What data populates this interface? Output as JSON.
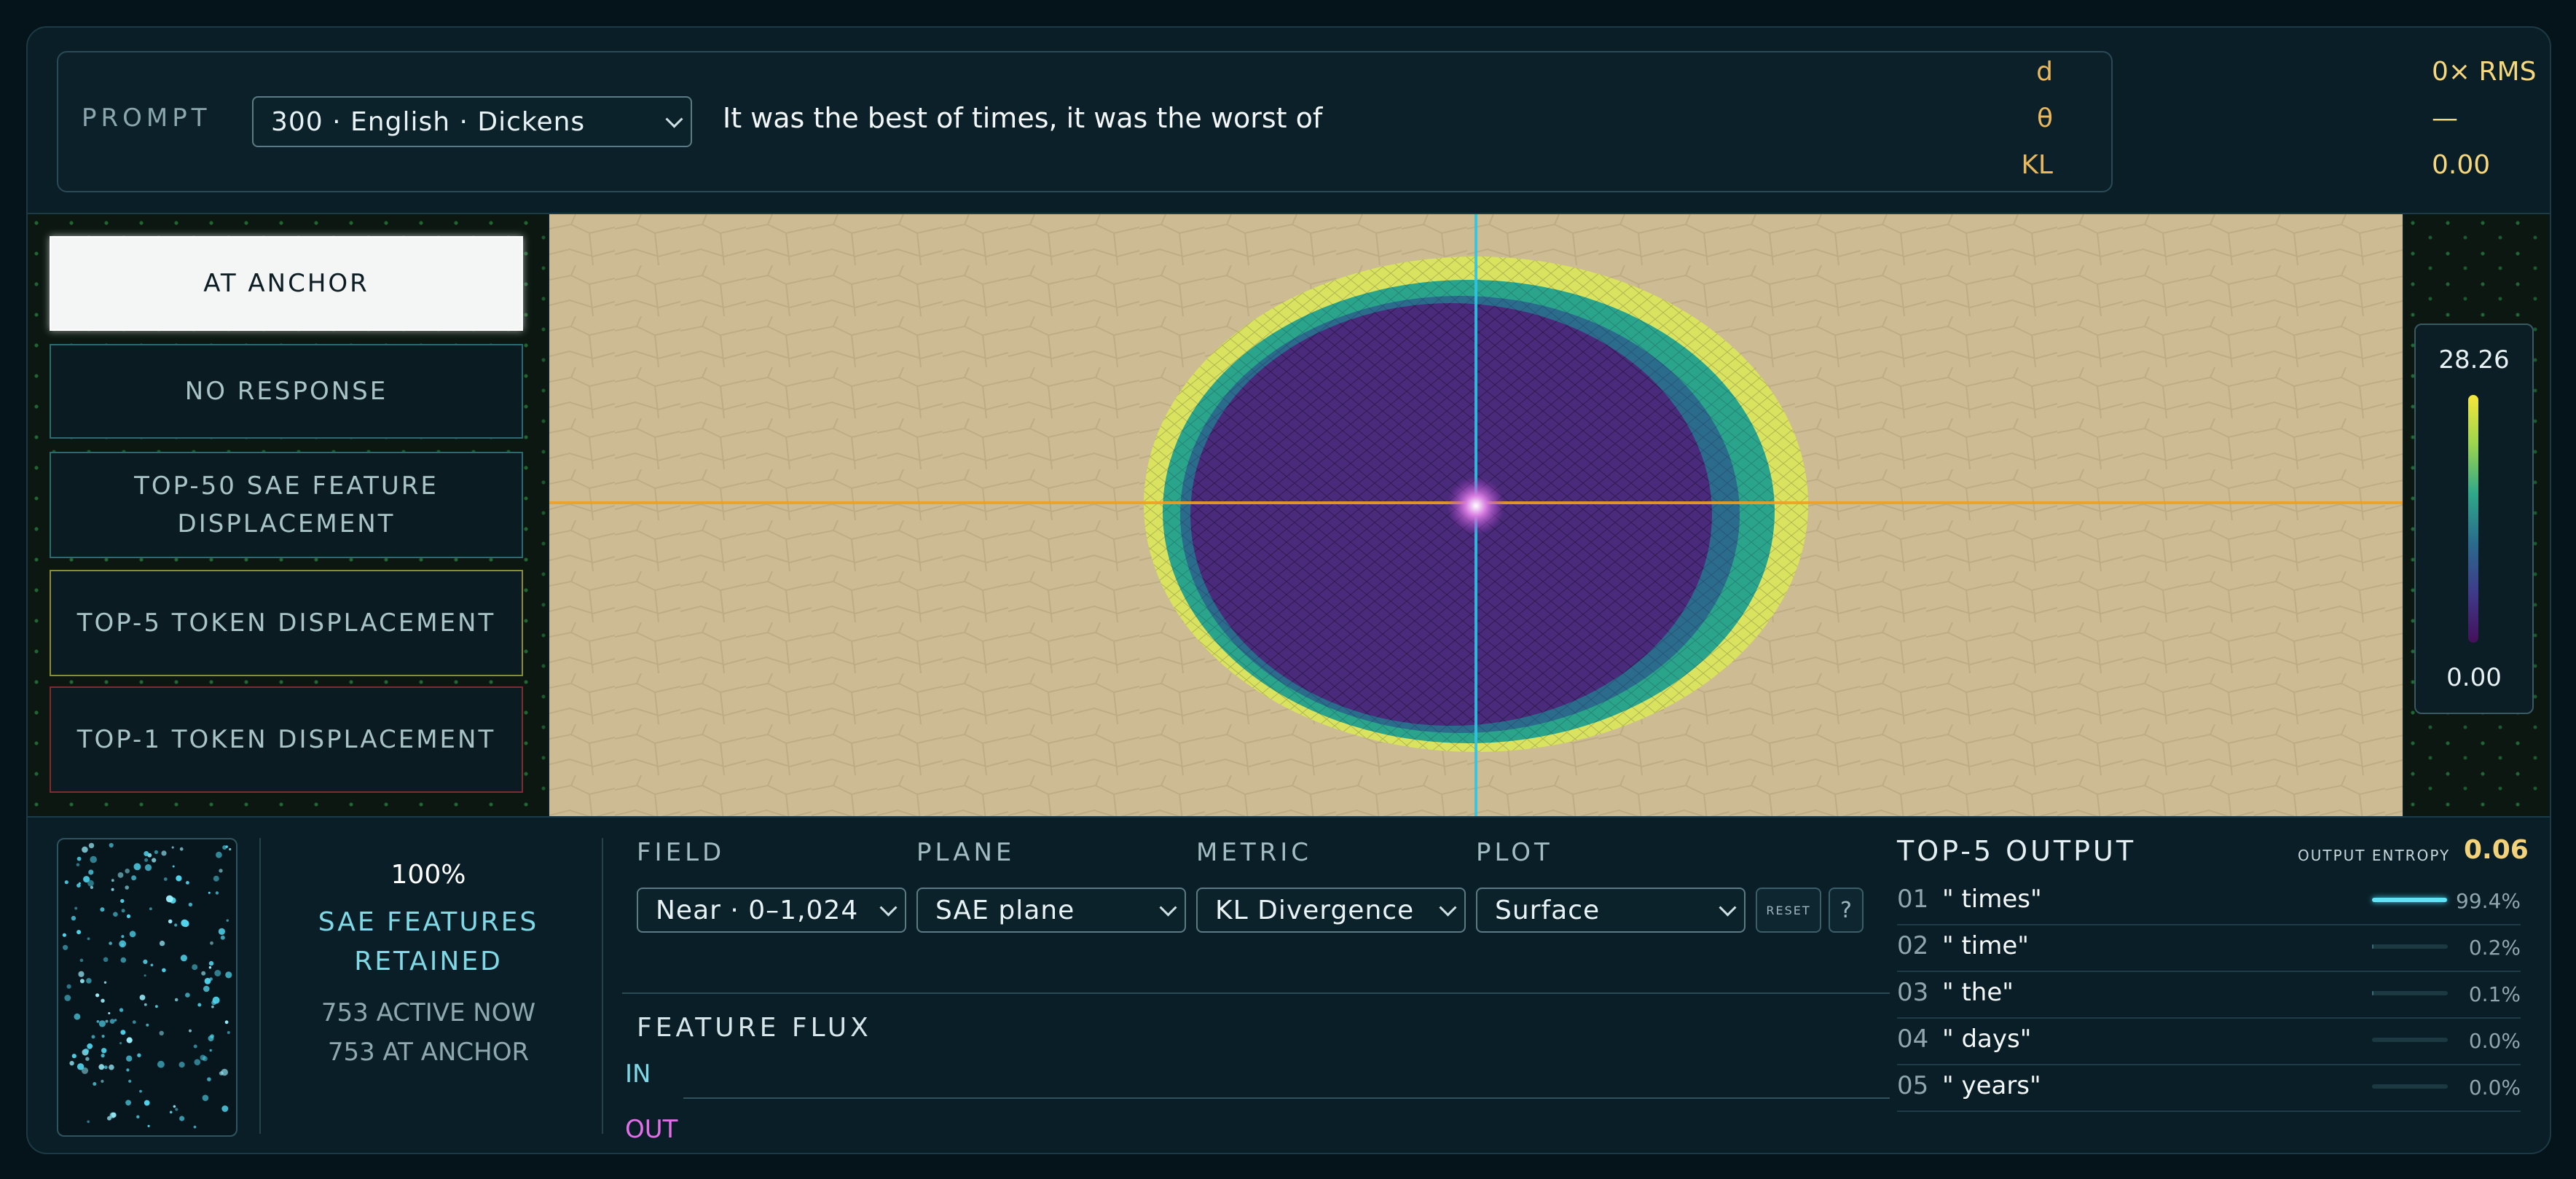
{
  "header": {
    "prompt_label": "PROMPT",
    "prompt_select": "300 · English · Dickens",
    "prompt_text": "It was the best of times, it was the worst of",
    "stats": [
      {
        "key": "d",
        "value": "0× RMS"
      },
      {
        "key": "θ",
        "value": "—"
      },
      {
        "key": "KL",
        "value": "0.00"
      }
    ]
  },
  "modes": [
    {
      "label": "AT ANCHOR",
      "active": true
    },
    {
      "label": "NO RESPONSE",
      "active": false
    },
    {
      "label": "TOP-50 SAE FEATURE DISPLACEMENT",
      "active": false
    },
    {
      "label": "TOP-5 TOKEN DISPLACEMENT",
      "active": false
    },
    {
      "label": "TOP-1 TOKEN DISPLACEMENT",
      "active": false
    }
  ],
  "colorscale": {
    "max": "28.26",
    "min": "0.00"
  },
  "retention": {
    "percent": "100%",
    "label_line1": "SAE FEATURES",
    "label_line2": "RETAINED",
    "active_now": "753 ACTIVE NOW",
    "at_anchor": "753 AT ANCHOR"
  },
  "controls": {
    "field_label": "FIELD",
    "field_value": "Near · 0–1,024",
    "plane_label": "PLANE",
    "plane_value": "SAE plane",
    "metric_label": "METRIC",
    "metric_value": "KL Divergence",
    "plot_label": "PLOT",
    "plot_value": "Surface",
    "reset_label": "RESET",
    "help_label": "?"
  },
  "flux": {
    "title": "FEATURE FLUX",
    "in_label": "IN",
    "out_label": "OUT"
  },
  "top5": {
    "title": "TOP-5 OUTPUT",
    "entropy_label": "OUTPUT ENTROPY",
    "entropy_value": "0.06",
    "rows": [
      {
        "rank": "01",
        "token": "\" times\"",
        "pct": "99.4%",
        "prob": 0.994
      },
      {
        "rank": "02",
        "token": "\" time\"",
        "pct": "0.2%",
        "prob": 0.002
      },
      {
        "rank": "03",
        "token": "\" the\"",
        "pct": "0.1%",
        "prob": 0.001
      },
      {
        "rank": "04",
        "token": "\" days\"",
        "pct": "0.0%",
        "prob": 0.0
      },
      {
        "rank": "05",
        "token": "\" years\"",
        "pct": "0.0%",
        "prob": 0.0
      }
    ]
  },
  "colors": {
    "accent_cyan": "#5fe3f5",
    "crosshair_orange": "#f0a020",
    "crosshair_cyan": "#2fc6e6",
    "gold": "#f4d27a"
  },
  "icons": {
    "dropdown": "chevron-down-icon",
    "hex_bg": "hexagon-grid-pattern"
  }
}
